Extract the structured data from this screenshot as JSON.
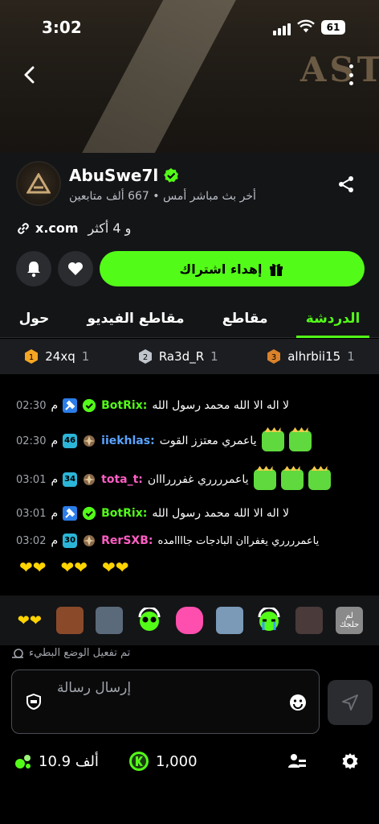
{
  "status": {
    "time": "3:02",
    "battery": "61"
  },
  "banner": {
    "logo_text": "AST"
  },
  "channel": {
    "name": "AbuSwe7l",
    "subtitle": "أخر بث مباشر أمس • 667 ألف متابعين",
    "link": "x.com",
    "more_links": "و 4 أكثر",
    "gift_label": "إهداء اشتراك"
  },
  "tabs": [
    {
      "label": "الدردشة",
      "active": true
    },
    {
      "label": "مقاطع",
      "active": false
    },
    {
      "label": "مقاطع الفيديو",
      "active": false
    },
    {
      "label": "حول",
      "active": false
    }
  ],
  "leaderboard": [
    {
      "rank": "1",
      "user": "24xq",
      "count": "1",
      "color": "#f5a623"
    },
    {
      "rank": "2",
      "user": "Ra3d_R",
      "count": "1",
      "color": "#c0c4cc"
    },
    {
      "rank": "3",
      "user": "alhrbii15",
      "count": "1",
      "color": "#d9822b"
    }
  ],
  "chat": {
    "messages": [
      {
        "time": "02:30",
        "ampm": "م",
        "user": "BotRix:",
        "text": "لا اله الا الله محمد رسول الله"
      },
      {
        "time": "02:30",
        "ampm": "م",
        "level": "46",
        "user": "iiekhlas:",
        "text": "ياعمري معتزز القوت"
      },
      {
        "time": "03:01",
        "ampm": "م",
        "level": "34",
        "user": "tota_t:",
        "text": "ياعمرررري غفرررااان"
      },
      {
        "time": "03:01",
        "ampm": "م",
        "user": "BotRix:",
        "text": "لا اله الا الله محمد رسول الله"
      },
      {
        "time": "03:02",
        "ampm": "م",
        "level": "30",
        "user": "RerSXB:",
        "text": "ياعمرررري يغفراان البادجات جاااامده"
      }
    ]
  },
  "emote_bar": {
    "last_label": "لم حلجك"
  },
  "slow_mode": "تم تفعيل الوضع البطيء",
  "input": {
    "placeholder": "إرسال رسالة"
  },
  "bottom": {
    "balance": "10.9 ألف",
    "kicks": "1,000"
  },
  "colors": {
    "accent": "#53fc18",
    "bg": "#000000",
    "panel": "#141517"
  }
}
